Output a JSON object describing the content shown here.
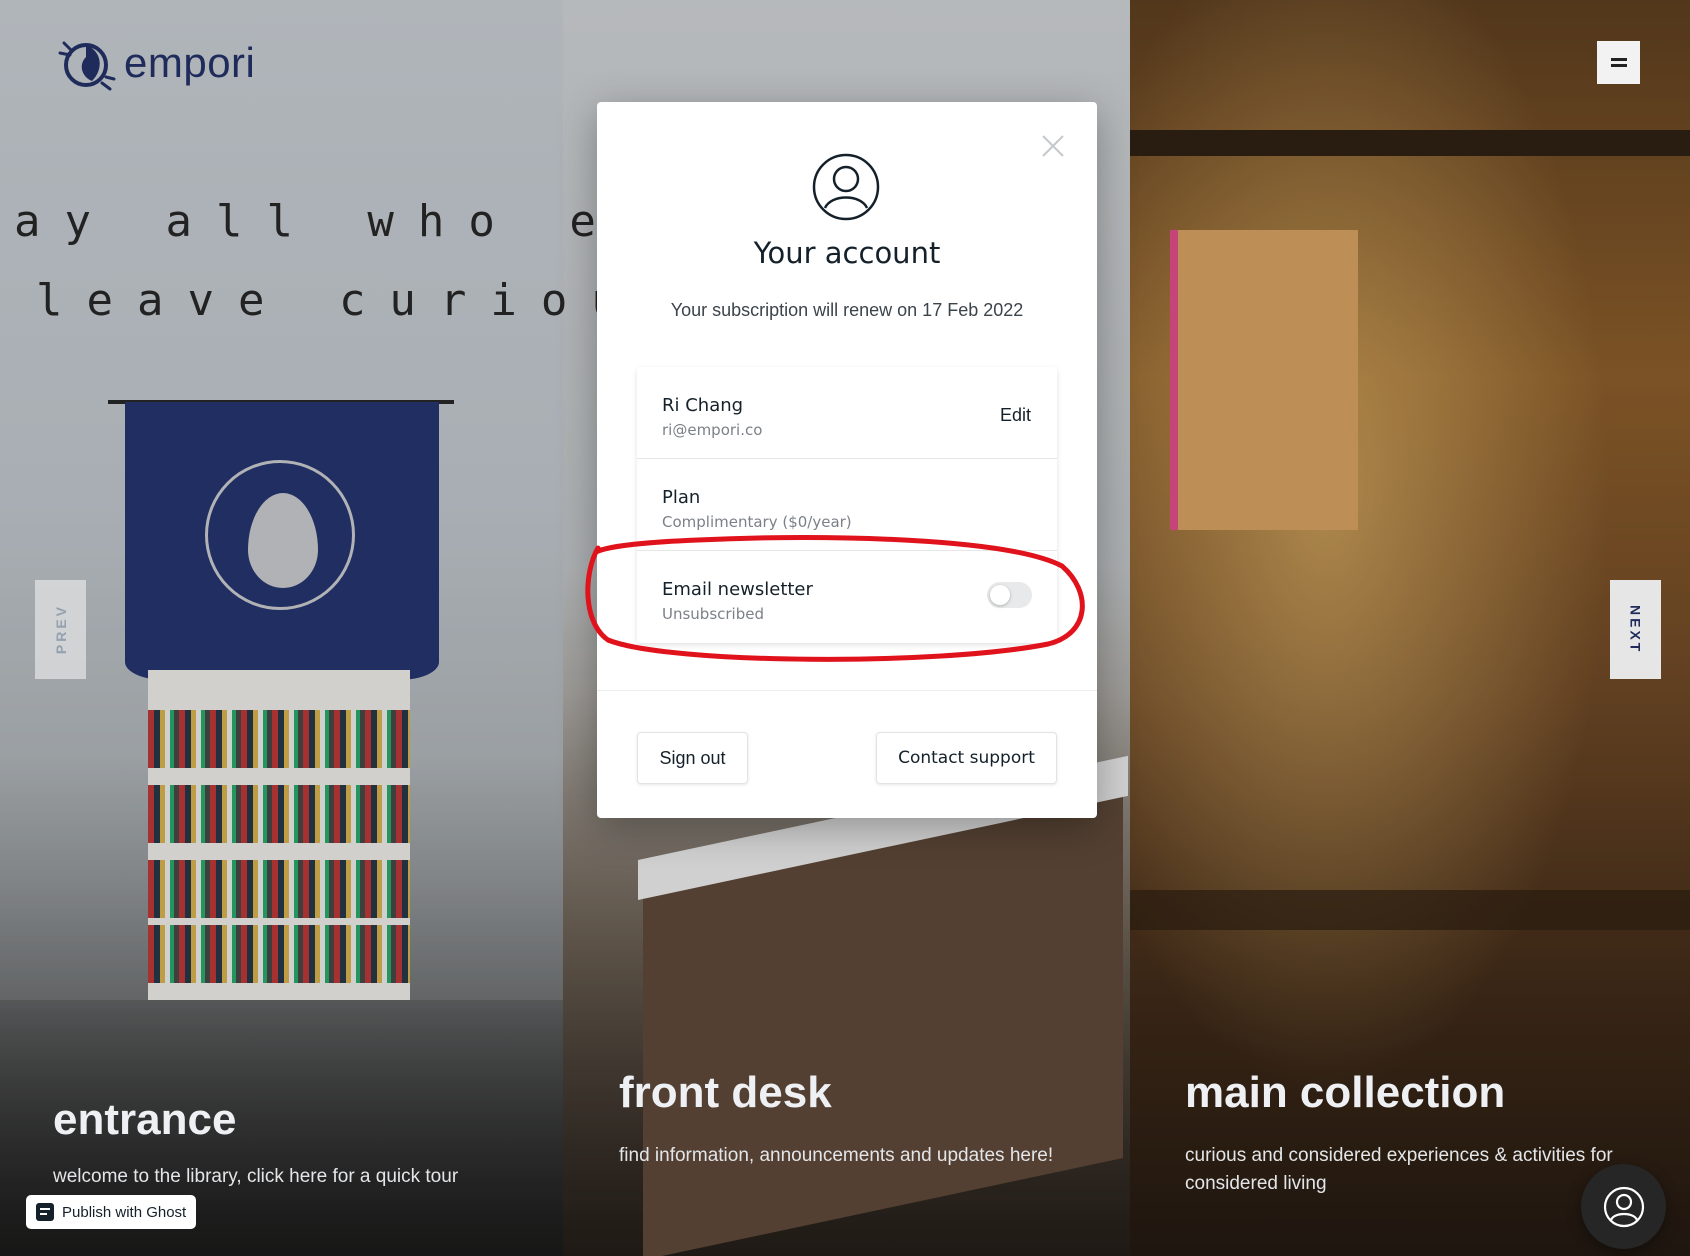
{
  "header": {
    "logo_text": "empori",
    "menu_icon": "hamburger-icon"
  },
  "hero": {
    "handwritten_line_1": "ay all who enter",
    "handwritten_line_2": "leave curious"
  },
  "nav": {
    "prev_label": "PREV",
    "next_label": "NEXT"
  },
  "panels": [
    {
      "title": "entrance",
      "description": "welcome to the library, click here for a quick tour"
    },
    {
      "title": "front desk",
      "description": "find information, announcements and updates here!"
    },
    {
      "title": "main collection",
      "description": "curious and considered experiences & activities for considered living"
    }
  ],
  "publish_button": {
    "label": "Publish with Ghost"
  },
  "account_modal": {
    "title": "Your account",
    "subscription_text": "Your subscription will renew on 17 Feb 2022",
    "profile": {
      "name": "Ri Chang",
      "email": "ri@empori.co",
      "edit_label": "Edit"
    },
    "plan": {
      "title": "Plan",
      "value": "Complimentary ($0/year)"
    },
    "newsletter": {
      "title": "Email newsletter",
      "status": "Unsubscribed",
      "subscribed": false
    },
    "footer": {
      "sign_out_label": "Sign out",
      "contact_support_label": "Contact support"
    }
  },
  "colors": {
    "brand_navy": "#1f2b5a",
    "annotation_red": "#e0121b",
    "modal_text": "#15212a"
  }
}
